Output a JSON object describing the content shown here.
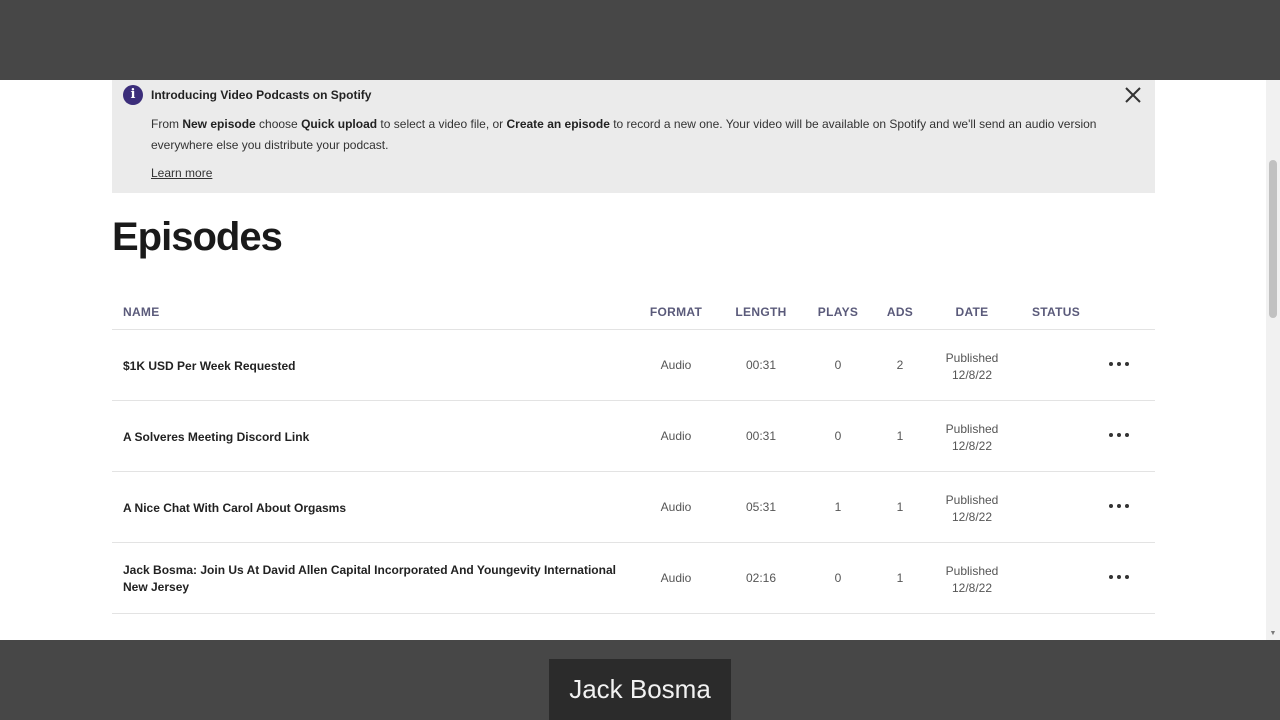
{
  "banner": {
    "title": "Introducing Video Podcasts on Spotify",
    "text_1": "From ",
    "bold_1": "New episode",
    "text_2": " choose ",
    "bold_2": "Quick upload",
    "text_3": " to select a video file, or ",
    "bold_3": "Create an episode",
    "text_4": " to record a new one. Your video will be available on Spotify and we'll send an audio version everywhere else you distribute your podcast.",
    "learn_more": "Learn more",
    "info_glyph": "i",
    "icon": "info-icon",
    "close_icon": "close-icon"
  },
  "page_title": "Episodes",
  "columns": {
    "name": "NAME",
    "format": "FORMAT",
    "length": "LENGTH",
    "plays": "PLAYS",
    "ads": "ADS",
    "date": "DATE",
    "status": "STATUS"
  },
  "episodes": [
    {
      "name": "$1K USD Per Week Requested",
      "format": "Audio",
      "length": "00:31",
      "plays": "0",
      "ads": "2",
      "status_line": "Published",
      "date": "12/8/22"
    },
    {
      "name": "A Solveres Meeting Discord Link",
      "format": "Audio",
      "length": "00:31",
      "plays": "0",
      "ads": "1",
      "status_line": "Published",
      "date": "12/8/22"
    },
    {
      "name": "A Nice Chat With Carol About Orgasms",
      "format": "Audio",
      "length": "05:31",
      "plays": "1",
      "ads": "1",
      "status_line": "Published",
      "date": "12/8/22"
    },
    {
      "name": "Jack Bosma: Join Us At David Allen Capital Incorporated And Youngevity International New Jersey",
      "format": "Audio",
      "length": "02:16",
      "plays": "0",
      "ads": "1",
      "status_line": "Published",
      "date": "12/8/22"
    }
  ],
  "caption": "Jack Bosma",
  "colors": {
    "letterbox": "#474747",
    "banner_bg": "#ebebeb",
    "info_icon": "#3b2d7a",
    "header_text": "#5a5a7a"
  }
}
